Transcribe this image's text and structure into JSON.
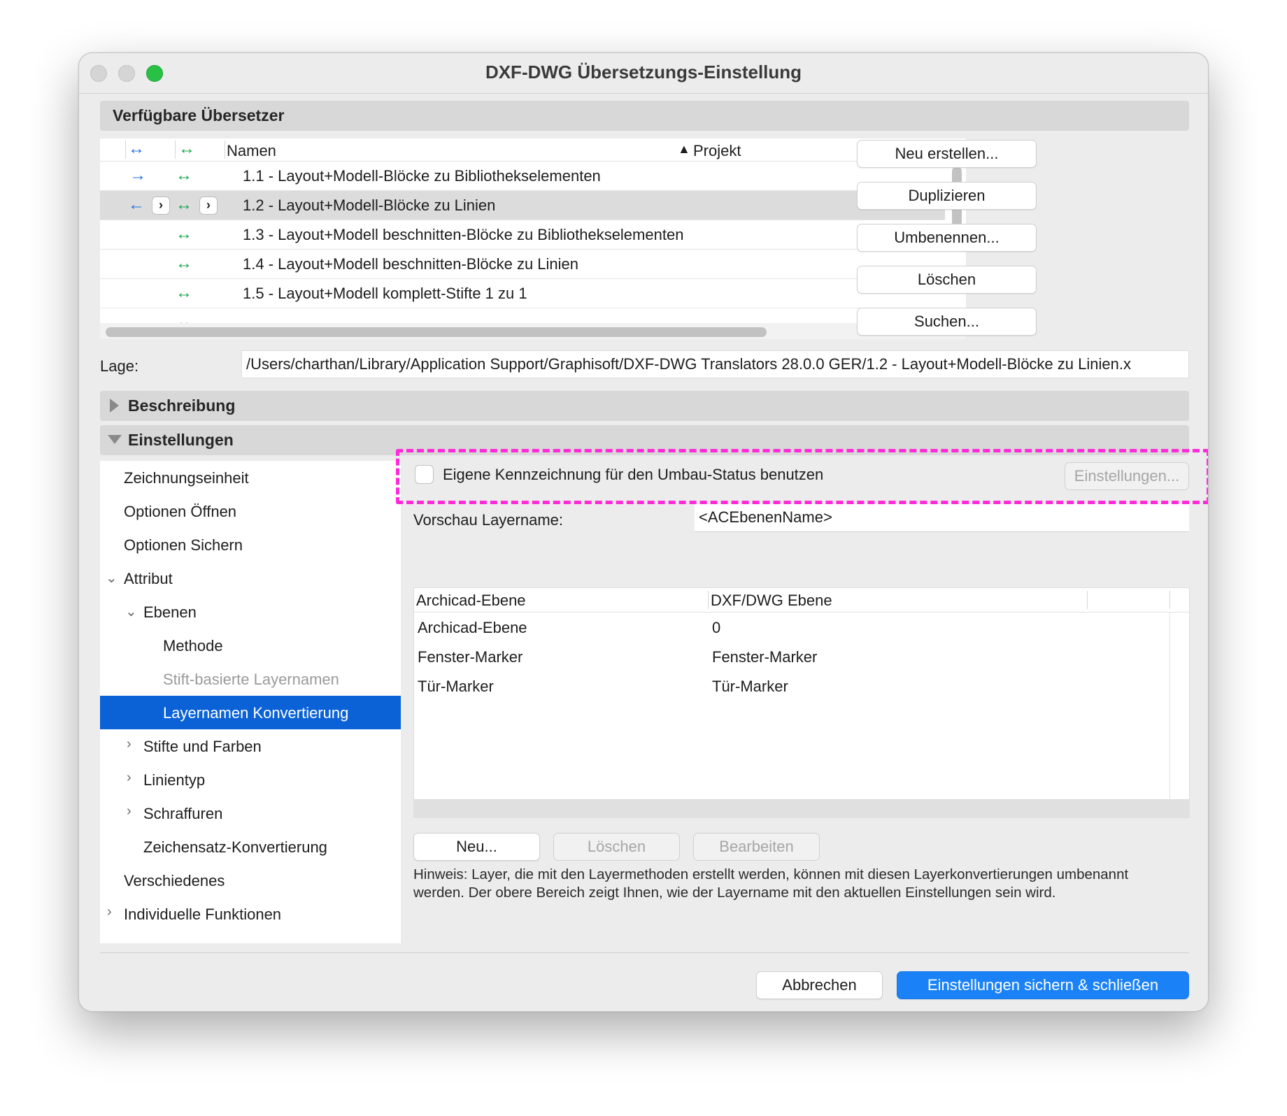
{
  "window": {
    "title": "DXF-DWG Übersetzungs-Einstellung"
  },
  "translators": {
    "section_title": "Verfügbare Übersetzer",
    "columns": {
      "names": "Namen",
      "project": "Projekt",
      "sort_indicator": "▲"
    },
    "rows": [
      {
        "name": "1.1 - Layout+Modell-Blöcke zu Bibliothekselementen",
        "arrow1": "→",
        "arrow2": "↔"
      },
      {
        "name": "1.2 - Layout+Modell-Blöcke zu Linien",
        "arrow1": "←",
        "arrow2": "↔",
        "selected": true
      },
      {
        "name": "1.3 - Layout+Modell beschnitten-Blöcke zu Bibliothekselementen",
        "arrow2": "↔"
      },
      {
        "name": "1.4 - Layout+Modell beschnitten-Blöcke zu Linien",
        "arrow2": "↔"
      },
      {
        "name": "1.5 - Layout+Modell komplett-Stifte 1 zu 1",
        "arrow2": "↔"
      }
    ],
    "buttons": {
      "new": "Neu erstellen...",
      "duplicate": "Duplizieren",
      "rename": "Umbenennen...",
      "delete": "Löschen",
      "search": "Suchen..."
    }
  },
  "location": {
    "label": "Lage:",
    "value": "/Users/charthan/Library/Application Support/Graphisoft/DXF-DWG Translators 28.0.0 GER/1.2 - Layout+Modell-Blöcke zu Linien.x"
  },
  "sections": {
    "description": "Beschreibung",
    "settings": "Einstellungen"
  },
  "tree": {
    "items": [
      "Zeichnungseinheit",
      "Optionen Öffnen",
      "Optionen Sichern",
      "Attribut",
      "Ebenen",
      "Methode",
      "Stift-basierte Layernamen",
      "Layernamen Konvertierung",
      "Stifte und Farben",
      "Linientyp",
      "Schraffuren",
      "Zeichensatz-Konvertierung",
      "Verschiedenes",
      "Individuelle Funktionen"
    ],
    "selected": "Layernamen Konvertierung"
  },
  "panel": {
    "renovation_checkbox_label": "Eigene Kennzeichnung für den Umbau-Status benutzen",
    "renovation_settings_button": "Einstellungen...",
    "preview_label": "Vorschau Layername:",
    "preview_value": "<ACEbenenName>",
    "layer_table": {
      "columns": [
        "Archicad-Ebene",
        "DXF/DWG Ebene"
      ],
      "rows": [
        [
          "Archicad-Ebene",
          "0"
        ],
        [
          "Fenster-Marker",
          "Fenster-Marker"
        ],
        [
          "Tür-Marker",
          "Tür-Marker"
        ]
      ]
    },
    "buttons": {
      "new": "Neu...",
      "delete": "Löschen",
      "edit": "Bearbeiten"
    },
    "hint": "Hinweis: Layer, die mit den Layermethoden erstellt werden, können mit diesen Layerkonvertierungen umbenannt werden. Der obere Bereich zeigt Ihnen, wie der Layername mit den aktuellen Einstellungen sein wird."
  },
  "footer": {
    "cancel": "Abbrechen",
    "save_close": "Einstellungen sichern & schließen"
  },
  "colors": {
    "accent": "#1a82f6",
    "selection": "#0a62d6",
    "highlight": "#ff2bd8",
    "arrow_blue": "#1f6fe0",
    "arrow_green": "#1aa64a"
  }
}
